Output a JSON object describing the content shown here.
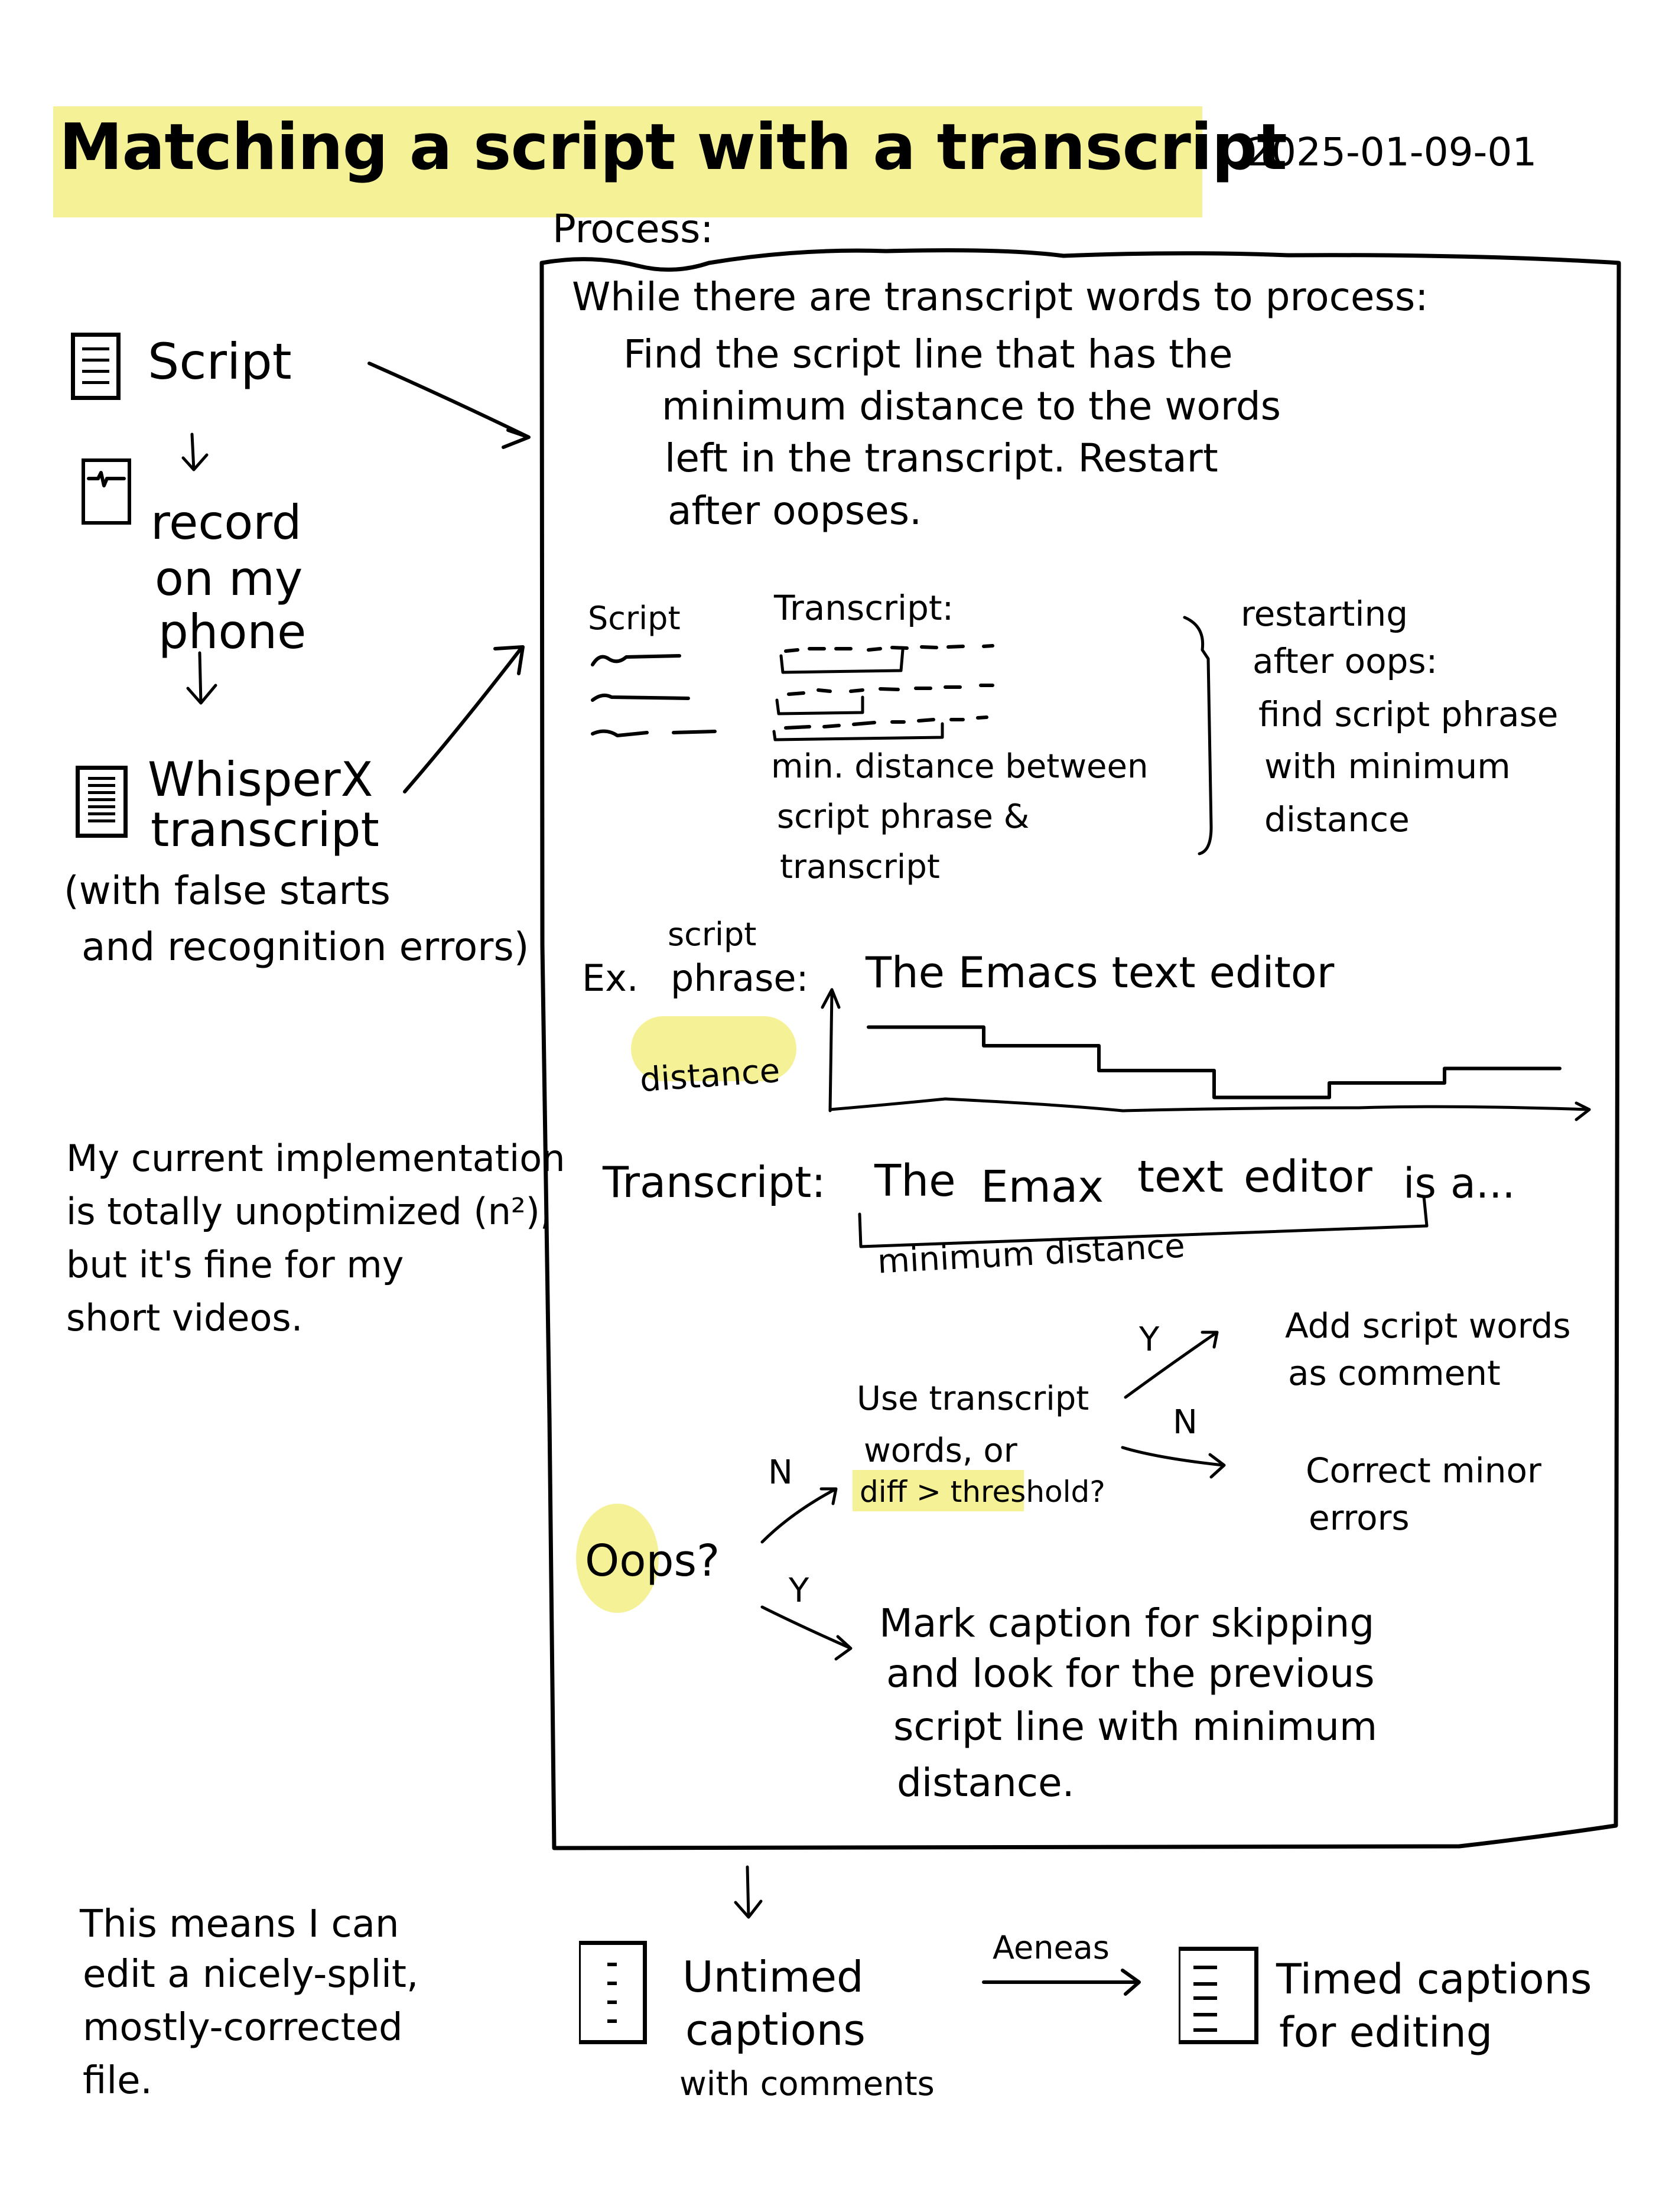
{
  "title": "Matching a script with a transcript",
  "date": "2025-01-09-01",
  "colors": {
    "highlight": "#f5f196",
    "ink": "#000000",
    "paper": "#ffffff"
  },
  "process_label": "Process:",
  "left_flow": {
    "script": {
      "icon": "document-icon",
      "label": "Script"
    },
    "record": {
      "icon": "audio-waveform-icon",
      "lines": [
        "record",
        "on my",
        "phone"
      ]
    },
    "whisperx": {
      "icon": "transcript-document-icon",
      "lines": [
        "WhisperX",
        "transcript"
      ],
      "note_lines": [
        "(with false starts",
        "and recognition errors)"
      ]
    }
  },
  "process_box": {
    "loop_lines": [
      "While there are transcript words to process:",
      "Find the script line that has the",
      "minimum distance to the words",
      "left in the transcript. Restart",
      "after oopses."
    ],
    "matching_sketch": {
      "script_header": "Script",
      "transcript_header": "Transcript:",
      "caption_lines": [
        "min. distance between",
        "script phrase &",
        "transcript"
      ],
      "brace_note_lines": [
        "restarting",
        "after oops:",
        "find script phrase",
        "with minimum",
        "distance"
      ]
    },
    "example": {
      "prefix": "Ex.",
      "label_top": "script",
      "label_bottom": "phrase:",
      "script_phrase": "The Emacs text editor",
      "y_axis_label": "distance",
      "transcript_label": "Transcript:",
      "transcript_words": [
        "The",
        "Emax",
        "text",
        "editor",
        "is",
        "a..."
      ],
      "bracket_label": "minimum distance",
      "distance_steps": [
        0.78,
        0.6,
        0.36,
        0.1,
        0.24,
        0.38
      ]
    },
    "decision": {
      "oops_label": "Oops?",
      "no_label": "N",
      "yes_label": "Y",
      "question_lines": [
        "Use transcript",
        "words, or"
      ],
      "question_highlight": "diff > threshold?",
      "yes_branch_lines": [
        "Add script words",
        "as comment"
      ],
      "no_branch_lines": [
        "Correct minor",
        "errors"
      ],
      "oops_yes_lines": [
        "Mark caption for skipping",
        "and look for the previous",
        "script line with minimum",
        "distance."
      ]
    }
  },
  "side_note_lines": [
    "My current implementation",
    "is totally unoptimized (n²),",
    "but it's fine for my",
    "short videos."
  ],
  "bottom": {
    "note_lines": [
      "This means I can",
      "edit a nicely-split,",
      "mostly-corrected",
      "file."
    ],
    "untimed": {
      "icon": "caption-file-icon",
      "lines": [
        "Untimed",
        "captions",
        "with comments"
      ]
    },
    "tool_label": "Aeneas",
    "timed": {
      "icon": "timed-caption-file-icon",
      "lines": [
        "Timed captions",
        "for editing"
      ]
    }
  }
}
